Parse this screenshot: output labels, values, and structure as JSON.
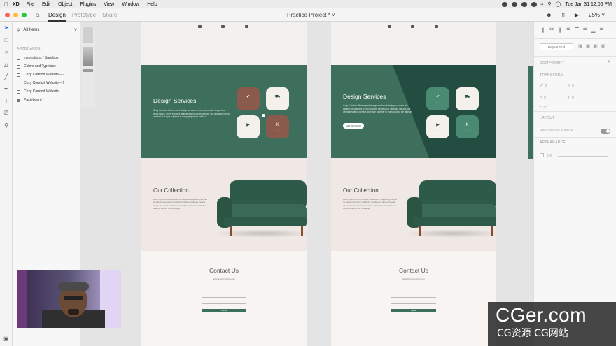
{
  "menubar": {
    "app": "XD",
    "menus": [
      "File",
      "Edit",
      "Object",
      "Plugins",
      "View",
      "Window",
      "Help"
    ],
    "clock": "Tue Jan 31  12:06 PM"
  },
  "titlebar": {
    "tabs": [
      "Design",
      "Prototype",
      "Share"
    ],
    "active_tab": "Design",
    "document_title": "Practice-Project *",
    "zoom": "25%"
  },
  "layers": {
    "filter_label": "All Items",
    "section_label": "ARTBOARDS",
    "items": [
      "Inspirations / Sandbox",
      "Colors and Typeface",
      "Cozy Comfort Website – 2",
      "Cozy Comfort Website – 1",
      "Cozy Comfort Website",
      "Pasteboard"
    ]
  },
  "artboard": {
    "design_services_title": "Design Services",
    "design_services_text": "Cozy Comfort offers expert design services to help you create the perfect living space. From furniture selection to full room layouts, our designers bring comfort and style together in every project we take on.",
    "button_label": "GET IN TOUCH",
    "collection_title": "Our Collection",
    "collection_text": "Lorem ipsum dolor sit amet consectetur adipiscing elit sed do eiusmod tempor incididunt ut labore et dolore magna aliqua ut enim ad minim veniam quis nostrud exercitation ullamco laboris nisi ut aliquip.",
    "contact_title": "Contact Us",
    "contact_subtitle": "hello@cozycomfort.com",
    "send_label": "SEND"
  },
  "properties": {
    "repeat_grid": "Repeat Grid",
    "component_label": "COMPONENT",
    "transform_label": "TRANSFORM",
    "layout_label": "LAYOUT",
    "responsive_resize": "Responsive Resize",
    "appearance_label": "APPEARANCE",
    "opacity": "0%"
  },
  "watermark": {
    "main": "CGer.com",
    "sub": "CG资源 CG网站"
  },
  "colors": {
    "green": "#3e6f5c",
    "dark_green": "#234d40",
    "brown": "#8a5a4c",
    "cream": "#f4f1ec"
  }
}
